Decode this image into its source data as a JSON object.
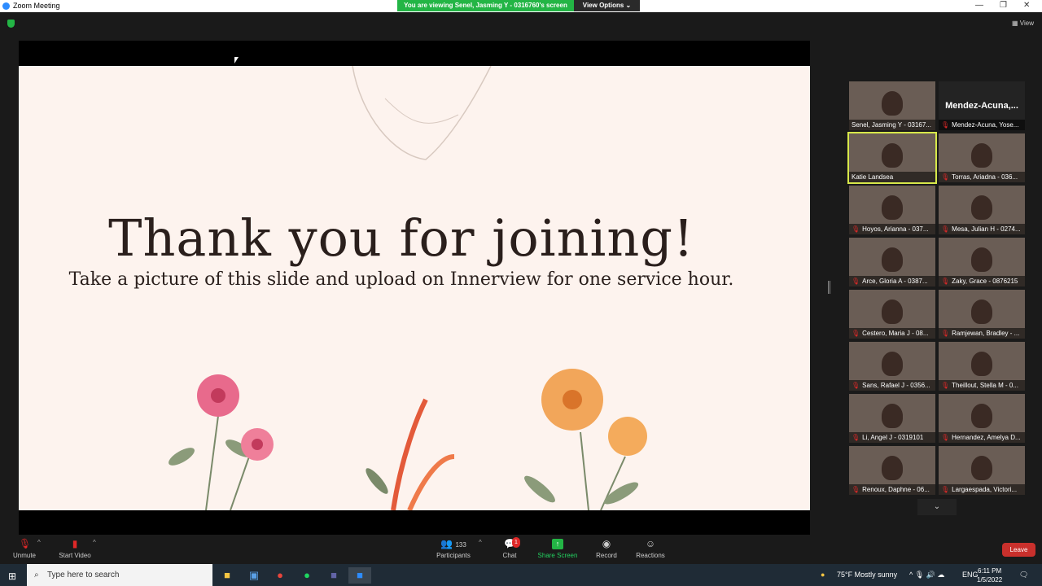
{
  "window": {
    "title": "Zoom Meeting",
    "banner": "You are viewing Senel, Jasming Y - 0316760's screen",
    "view_options": "View Options ⌄",
    "view": "View"
  },
  "slide": {
    "title": "Thank you for joining!",
    "subtitle": "Take a picture of this slide and upload on Innerview for one service hour."
  },
  "gallery": [
    {
      "name": "Senel, Jasming Y - 03167...",
      "muted": false
    },
    {
      "name": "Mendez-Acuna, Yose...",
      "muted": true,
      "display": "Mendez-Acuna,..."
    },
    {
      "name": "Katie Landsea",
      "muted": false,
      "active": true
    },
    {
      "name": "Torras, Ariadna - 036...",
      "muted": true
    },
    {
      "name": "Hoyos, Arianna - 037...",
      "muted": true
    },
    {
      "name": "Mesa, Julian H - 0274...",
      "muted": true
    },
    {
      "name": "Arce, Gloria A - 0387...",
      "muted": true
    },
    {
      "name": "Zaky, Grace - 0876215",
      "muted": true
    },
    {
      "name": "Cestero, Maria J - 08...",
      "muted": true
    },
    {
      "name": "Ramjewan, Bradley - ...",
      "muted": true
    },
    {
      "name": "Sans, Rafael J - 0356...",
      "muted": true
    },
    {
      "name": "Theillout, Stella M - 0...",
      "muted": true
    },
    {
      "name": "Li, Angel J - 0319101",
      "muted": true
    },
    {
      "name": "Hernandez, Amelya D...",
      "muted": true
    },
    {
      "name": "Renoux, Daphne - 06...",
      "muted": true
    },
    {
      "name": "Largaespada, Victori...",
      "muted": true
    }
  ],
  "toolbar": {
    "unmute": "Unmute",
    "start_video": "Start Video",
    "participants": "Participants",
    "participants_count": "133",
    "chat": "Chat",
    "chat_badge": "1",
    "share_screen": "Share Screen",
    "record": "Record",
    "reactions": "Reactions",
    "leave": "Leave"
  },
  "taskbar": {
    "search_placeholder": "Type here to search",
    "weather": "75°F  Mostly sunny",
    "lang": "ENG",
    "time": "6:11 PM",
    "date": "1/5/2022"
  }
}
